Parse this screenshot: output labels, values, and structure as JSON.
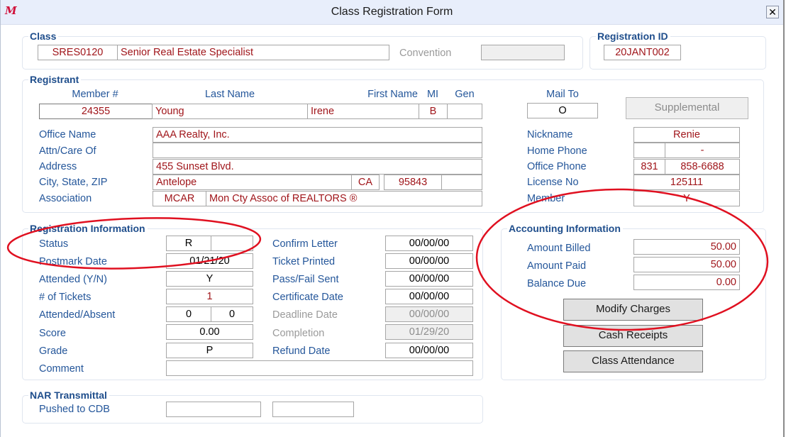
{
  "window": {
    "title": "Class Registration Form",
    "app_icon": "app-logo-icon",
    "close_label": "✕"
  },
  "class_section": {
    "legend": "Class",
    "code": "SRES0120",
    "name": "Senior Real Estate Specialist",
    "convention_label": "Convention",
    "convention_value": ""
  },
  "registration_id": {
    "legend": "Registration ID",
    "value": "20JANT002"
  },
  "registrant": {
    "legend": "Registrant",
    "headers": {
      "member_no": "Member #",
      "last_name": "Last Name",
      "first_name": "First Name",
      "mi": "MI",
      "gen": "Gen",
      "mail_to": "Mail To"
    },
    "member_no": "24355",
    "last_name": "Young",
    "first_name": "Irene",
    "mi": "B",
    "gen": "",
    "mail_to": "O",
    "supplemental_button": "Supplemental",
    "labels": {
      "office_name": "Office Name",
      "attn": "Attn/Care Of",
      "address": "Address",
      "city_state_zip": "City, State, ZIP",
      "association": "Association",
      "nickname": "Nickname",
      "home_phone": "Home Phone",
      "office_phone": "Office Phone",
      "license_no": "License No",
      "member": "Member"
    },
    "office_name": "AAA Realty, Inc.",
    "attn": "",
    "address": "455 Sunset Blvd.",
    "city": "Antelope",
    "state": "CA",
    "zip": "95843",
    "zip_ext": "",
    "association_code": "MCAR",
    "association_name": "Mon Cty Assoc of REALTORS ®",
    "nickname": "Renie",
    "home_phone_area": "",
    "home_phone": "-",
    "office_phone_area": "831",
    "office_phone": "858-6688",
    "license_no": "125111",
    "member": "Y"
  },
  "registration_info": {
    "legend": "Registration Information",
    "labels": {
      "status": "Status",
      "postmark_date": "Postmark Date",
      "attended": "Attended (Y/N)",
      "tickets": "# of Tickets",
      "attended_absent": "Attended/Absent",
      "score": "Score",
      "grade": "Grade",
      "comment": "Comment",
      "confirm_letter": "Confirm Letter",
      "ticket_printed": "Ticket Printed",
      "pass_fail_sent": "Pass/Fail Sent",
      "certificate_date": "Certificate Date",
      "deadline_date": "Deadline Date",
      "completion": "Completion",
      "refund_date": "Refund Date"
    },
    "status": "R",
    "status_2": "",
    "postmark_date": "01/21/20",
    "attended": "Y",
    "tickets": "1",
    "attended_count": "0",
    "absent_count": "0",
    "score": "0.00",
    "grade": "P",
    "comment": "",
    "confirm_letter": "00/00/00",
    "ticket_printed": "00/00/00",
    "pass_fail_sent": "00/00/00",
    "certificate_date": "00/00/00",
    "deadline_date": "00/00/00",
    "completion": "01/29/20",
    "refund_date": "00/00/00"
  },
  "accounting": {
    "legend": "Accounting Information",
    "labels": {
      "billed": "Amount Billed",
      "paid": "Amount Paid",
      "balance": "Balance Due"
    },
    "billed": "50.00",
    "paid": "50.00",
    "balance": "0.00",
    "buttons": {
      "modify_charges": "Modify Charges",
      "cash_receipts": "Cash Receipts",
      "class_attendance": "Class Attendance"
    }
  },
  "nar_transmittal": {
    "legend": "NAR Transmittal",
    "pushed_label": "Pushed to CDB",
    "pushed_value_1": "",
    "pushed_value_2": ""
  },
  "colors": {
    "label_blue": "#24569a",
    "legend_blue": "#1f4e8c",
    "value_red": "#a0161b",
    "annotation_red": "#e01020",
    "titlebar_bg": "#e8eefb"
  }
}
